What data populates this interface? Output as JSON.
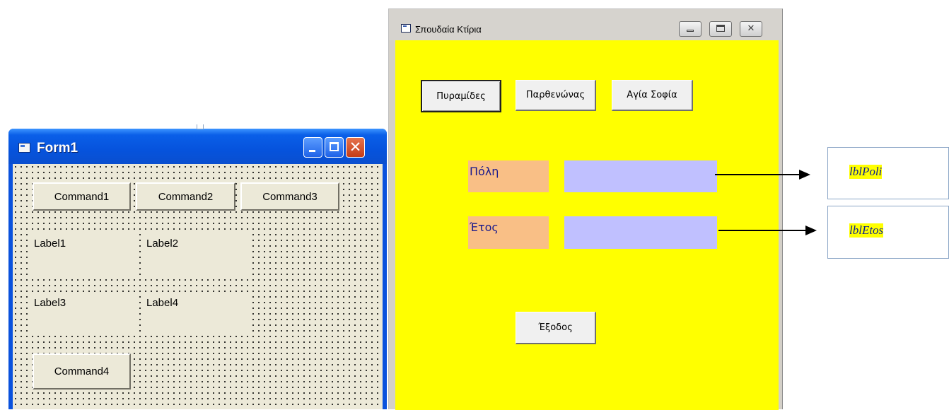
{
  "form1": {
    "title": "Form1",
    "buttons": {
      "command1": "Command1",
      "command2": "Command2",
      "command3": "Command3",
      "command4": "Command4"
    },
    "labels": {
      "label1": "Label1",
      "label2": "Label2",
      "label3": "Label3",
      "label4": "Label4"
    }
  },
  "form2": {
    "title": "Σπουδαία Κτίρια",
    "buttons": {
      "pyramids": "Πυραμίδες",
      "parthenon": "Παρθενώνας",
      "hagia_sophia": "Αγία Σοφία",
      "exit": "Έξοδος"
    },
    "labels": {
      "city": "Πόλη",
      "year": "Έτος"
    },
    "colors": {
      "background": "#ffff00",
      "caption_label": "#f9bf86",
      "value_label": "#c0c0ff"
    }
  },
  "annotations": {
    "poli": "lblPoli",
    "etos": "lblEtos"
  }
}
